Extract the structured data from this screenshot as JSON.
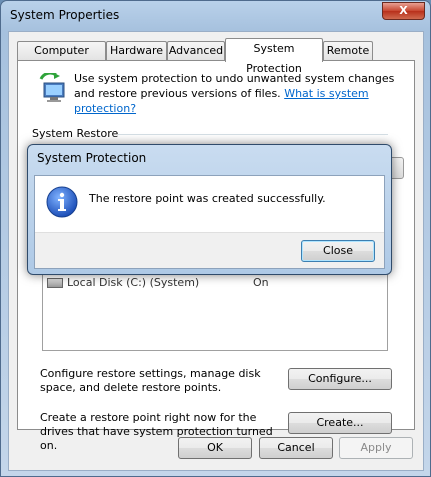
{
  "window": {
    "title": "System Properties",
    "close_glyph": "X"
  },
  "tabs": [
    {
      "label": "Computer Name",
      "active": false
    },
    {
      "label": "Hardware",
      "active": false
    },
    {
      "label": "Advanced",
      "active": false
    },
    {
      "label": "System Protection",
      "active": true
    },
    {
      "label": "Remote",
      "active": false
    }
  ],
  "intro": {
    "text": "Use system protection to undo unwanted system changes and restore previous versions of files.",
    "link": "What is system protection?",
    "icon": "system-protection-icon"
  },
  "system_restore": {
    "section_label": "System Restore"
  },
  "drives": {
    "rows": [
      {
        "name": "Local Disk (C:) (System)",
        "status": "On"
      }
    ]
  },
  "configure": {
    "text": "Configure restore settings, manage disk space, and delete restore points.",
    "button": "Configure..."
  },
  "create": {
    "text": "Create a restore point right now for the drives that have system protection turned on.",
    "button": "Create..."
  },
  "footer": {
    "ok": "OK",
    "cancel": "Cancel",
    "apply": "Apply"
  },
  "dialog": {
    "title": "System Protection",
    "message": "The restore point was created successfully.",
    "icon": "info-icon",
    "close_button": "Close"
  }
}
